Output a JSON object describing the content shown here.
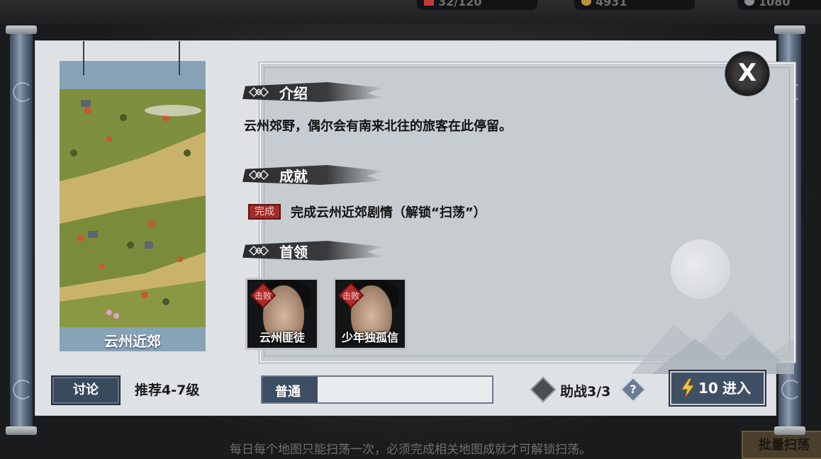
{
  "top_resources": [
    {
      "value": "32/120",
      "icon": "vitality-icon",
      "color": "#c23a3a"
    },
    {
      "value": "4931",
      "icon": "coin-icon",
      "color": "#b5913f"
    },
    {
      "value": "1080",
      "icon": "gem-icon",
      "color": "#8a8e92"
    }
  ],
  "map": {
    "name": "云州近郊"
  },
  "sections": {
    "intro": {
      "title": "介绍",
      "text": "云州郊野，偶尔会有南来北往的旅客在此停留。"
    },
    "achievement": {
      "title": "成就",
      "stamp": "完成",
      "text": "完成云州近郊剧情（解锁“扫荡”）"
    },
    "bosses": {
      "title": "首领",
      "items": [
        {
          "name": "云州匪徒",
          "defeated_mark": "击败"
        },
        {
          "name": "少年独孤信",
          "defeated_mark": "击败"
        }
      ]
    }
  },
  "footer": {
    "discuss_label": "讨论",
    "recommend_label": "推荐4-7级",
    "difficulty_label": "普通",
    "difficulty_fill_pct": 24,
    "assist_label": "助战3/3",
    "help_symbol": "?",
    "enter_cost": "10",
    "enter_label": "进入"
  },
  "close_symbol": "X",
  "bottom_tip": "每日每个地图只能扫荡一次，必须完成相关地图成就才可解锁扫荡。",
  "batch_button_label": "批量扫荡",
  "colors": {
    "panel": "#dfe2e5",
    "accent_dark": "#3d4e62",
    "stamp_red": "#a32b2b"
  }
}
